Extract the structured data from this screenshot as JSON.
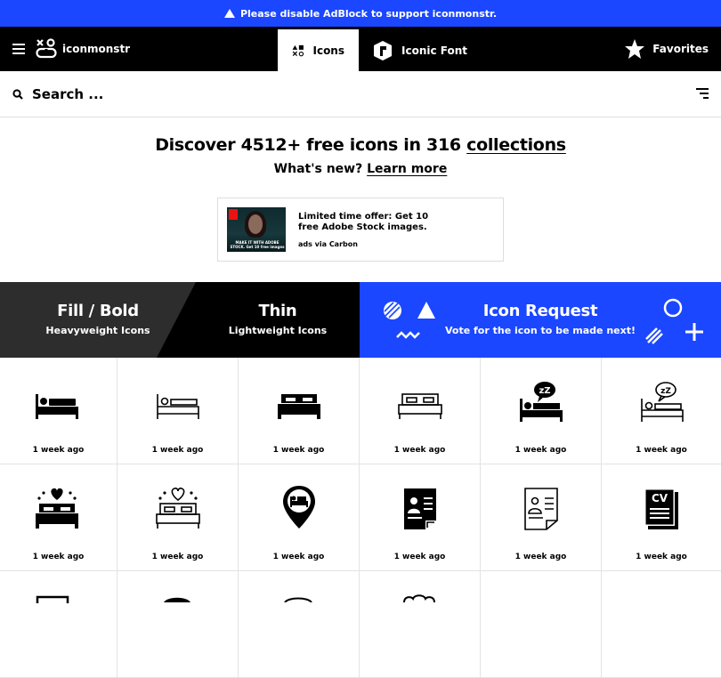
{
  "adbar": {
    "text": "Please disable AdBlock to support iconmonstr."
  },
  "header": {
    "logo_text": "iconmonstr",
    "tabs": [
      {
        "label": "Icons",
        "active": true
      },
      {
        "label": "Iconic Font",
        "active": false
      }
    ],
    "favorites_label": "Favorites"
  },
  "search": {
    "placeholder": "Search ..."
  },
  "hero": {
    "title_prefix": "Discover 4512+ free icons in 316",
    "title_link": "collections",
    "subtitle_prefix": "What's new?",
    "subtitle_link": "Learn more"
  },
  "ad": {
    "text": "Limited time offer: Get 10 free Adobe Stock images.",
    "via": "ads via Carbon",
    "thumb_caption": "MAKE IT WITH ADOBE STOCK. Get 10 free images"
  },
  "banner": {
    "fill": {
      "title": "Fill / Bold",
      "sub": "Heavyweight Icons"
    },
    "thin": {
      "title": "Thin",
      "sub": "Lightweight Icons"
    },
    "request": {
      "title": "Icon Request",
      "sub": "Vote for the icon to be made next!"
    }
  },
  "icons": [
    {
      "name": "bed-person-fill-icon",
      "time": "1 week ago"
    },
    {
      "name": "bed-person-thin-icon",
      "time": "1 week ago"
    },
    {
      "name": "double-bed-fill-icon",
      "time": "1 week ago"
    },
    {
      "name": "double-bed-thin-icon",
      "time": "1 week ago"
    },
    {
      "name": "sleeping-person-fill-icon",
      "time": "1 week ago"
    },
    {
      "name": "sleeping-person-thin-icon",
      "time": "1 week ago"
    },
    {
      "name": "honeymoon-bed-fill-icon",
      "time": "1 week ago"
    },
    {
      "name": "honeymoon-bed-thin-icon",
      "time": "1 week ago"
    },
    {
      "name": "hotel-location-pin-icon",
      "time": "1 week ago"
    },
    {
      "name": "resume-fill-icon",
      "time": "1 week ago"
    },
    {
      "name": "resume-thin-icon",
      "time": "1 week ago"
    },
    {
      "name": "cv-document-icon",
      "time": "1 week ago"
    }
  ],
  "cv_label": "CV"
}
